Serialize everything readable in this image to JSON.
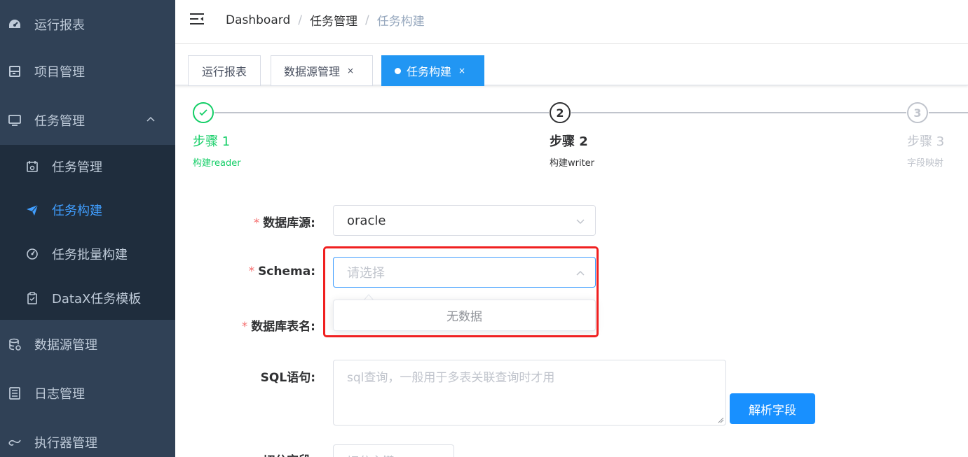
{
  "sidebar": {
    "items": [
      {
        "label": "运行报表",
        "icon": "dashboard-icon"
      },
      {
        "label": "项目管理",
        "icon": "project-icon"
      },
      {
        "label": "任务管理",
        "icon": "monitor-icon"
      },
      {
        "label": "数据源管理",
        "icon": "database-icon"
      },
      {
        "label": "日志管理",
        "icon": "log-icon"
      },
      {
        "label": "执行器管理",
        "icon": "executor-icon"
      }
    ],
    "submenu": [
      {
        "label": "任务管理",
        "icon": "calendar-icon"
      },
      {
        "label": "任务构建",
        "icon": "paper-plane-icon"
      },
      {
        "label": "任务批量构建",
        "icon": "gauge-icon"
      },
      {
        "label": "DataX任务模板",
        "icon": "clipboard-icon"
      }
    ],
    "active_color": "#409eff",
    "bg_color": "#304156",
    "sub_bg_color": "#1f2d3d"
  },
  "header": {
    "breadcrumb": [
      "Dashboard",
      "任务管理",
      "任务构建"
    ],
    "separator": "/"
  },
  "tags": [
    {
      "label": "运行报表",
      "close": ""
    },
    {
      "label": "数据源管理",
      "close": "×"
    },
    {
      "label": "任务构建",
      "close": "×"
    }
  ],
  "steps": [
    {
      "title": "步骤 1",
      "desc": "构建reader",
      "number": "",
      "status": "success"
    },
    {
      "title": "步骤 2",
      "desc": "构建writer",
      "number": "2",
      "status": "process"
    },
    {
      "title": "步骤 3",
      "desc": "字段映射",
      "number": "3",
      "status": "wait"
    }
  ],
  "form": {
    "datasource": {
      "label": "数据库源:",
      "value": "oracle"
    },
    "schema": {
      "label": "Schema:",
      "placeholder": "请选择",
      "dropdown_empty": "无数据"
    },
    "table": {
      "label": "数据库表名:"
    },
    "sql": {
      "label": "SQL语句:",
      "placeholder": "sql查询，一般用于多表关联查询时才用"
    },
    "parse_button": "解析字段",
    "split": {
      "label": "切分字段:",
      "placeholder": "切分主键"
    }
  },
  "colors": {
    "primary": "#1890ff",
    "success": "#13ce66",
    "required": "#f56c6c",
    "highlight": "#f02020"
  }
}
